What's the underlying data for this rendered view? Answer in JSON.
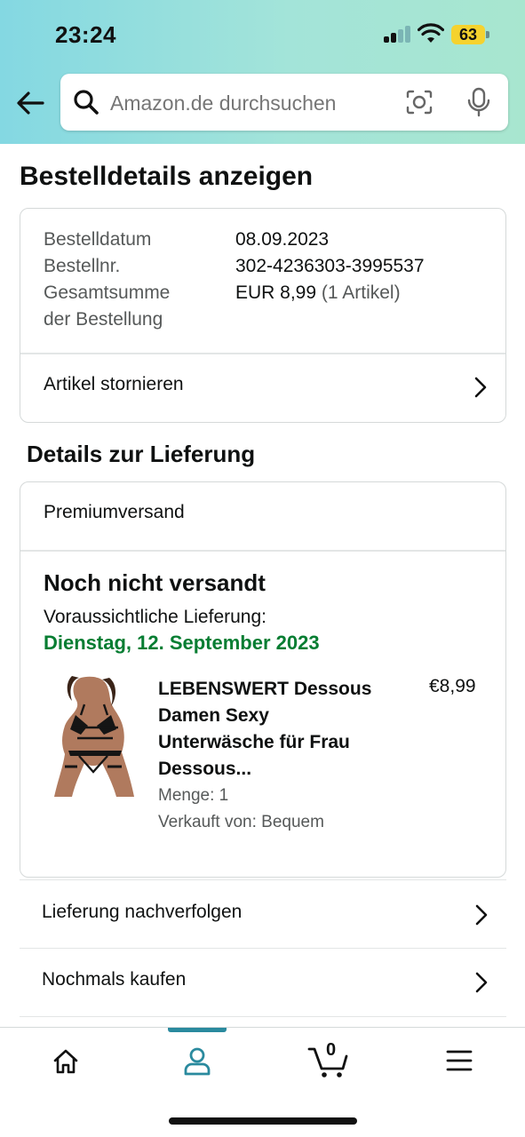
{
  "status_bar": {
    "time": "23:24",
    "battery": "63"
  },
  "search": {
    "placeholder": "Amazon.de durchsuchen"
  },
  "page": {
    "title": "Bestelldetails anzeigen"
  },
  "order_summary": {
    "date_label": "Bestelldatum",
    "date_value": "08.09.2023",
    "number_label": "Bestellnr.",
    "number_value": "302-4236303-3995537",
    "total_label_line1": "Gesamtsumme",
    "total_label_line2": "der Bestellung",
    "total_value": "EUR 8,99",
    "total_items": "(1 Artikel)",
    "cancel_link": "Artikel stornieren"
  },
  "delivery": {
    "section_title": "Details zur Lieferung",
    "shipping_method": "Premiumversand",
    "status": "Noch nicht versandt",
    "eta_label": "Voraussichtliche Lieferung:",
    "eta_date": "Dienstag, 12. September 2023",
    "colors": {
      "eta": "#067d32"
    },
    "item": {
      "title": "LEBENSWERT Dessous Damen Sexy Unterwäsche für Frau Dessous...",
      "price": "€8,99",
      "quantity": "Menge: 1",
      "seller": "Verkauft von: Bequem"
    }
  },
  "actions": [
    {
      "label": "Lieferung nachverfolgen"
    },
    {
      "label": "Nochmals kaufen"
    }
  ],
  "tabbar": {
    "tabs": [
      "home-icon",
      "account-icon",
      "cart-icon",
      "menu-icon"
    ],
    "active": "account-icon",
    "cart_count": "0",
    "accent_color": "#2a8a9e"
  }
}
